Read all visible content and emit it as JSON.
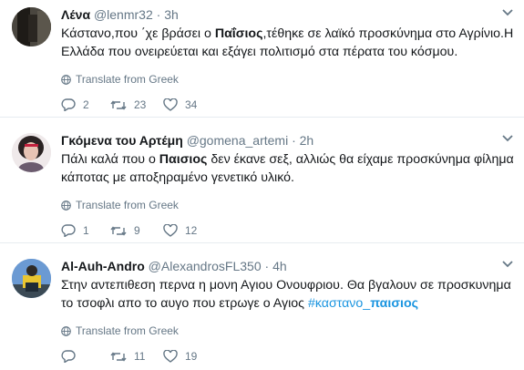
{
  "tweets": [
    {
      "name": "Λένα",
      "handle": "@lenmr32",
      "time": "3h",
      "text_parts": [
        "Κάστανο,που ΄χε βράσει ο ",
        "Παΐσιος",
        ",τέθηκε σε λαϊκό προσκύνημα στο Αγρίνιο.Η Ελλάδα που ονειρεύεται και εξάγει πολιτισμό στα πέρατα του κόσμου."
      ],
      "translate": "Translate from Greek",
      "replies": "2",
      "retweets": "23",
      "likes": "34"
    },
    {
      "name": "Γκόμενα του Αρτέμη",
      "handle": "@gomena_artemi",
      "time": "2h",
      "text_parts": [
        "Πάλι καλά που ο ",
        "Παισιος",
        " δεν έκανε σεξ, αλλιώς θα είχαμε προσκύνημα φίλημα κάποτας με αποξηραμένο γενετικό υλικό."
      ],
      "translate": "Translate from Greek",
      "replies": "1",
      "retweets": "9",
      "likes": "12"
    },
    {
      "name": "Al-Auh-Andro",
      "handle": "@AlexandrosFL350",
      "time": "4h",
      "text_parts": [
        "Στην αντεπιθεση περνα η μονη Αγιου Ονουφριου. Θα βγαλουν σε προσκυνημα το τσοφλι απο το αυγο που ετρωγε ο Αγιος "
      ],
      "hashtag_parts": [
        "#καστανο_",
        "παισιος"
      ],
      "translate": "Translate from Greek",
      "replies": "",
      "retweets": "11",
      "likes": "19"
    }
  ],
  "colors": {
    "text": "#14171a",
    "secondary": "#657786",
    "link": "#1b95e0",
    "divider": "#e6ecf0"
  },
  "icons": [
    "reply-icon",
    "retweet-icon",
    "like-icon",
    "globe-icon",
    "chevron-down-icon"
  ]
}
